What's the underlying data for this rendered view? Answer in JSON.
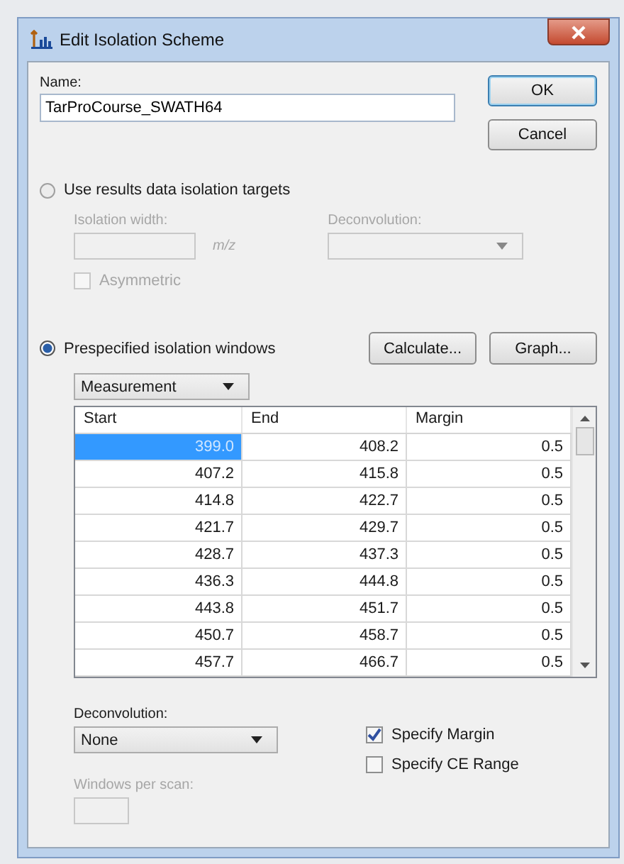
{
  "window": {
    "title": "Edit Isolation Scheme"
  },
  "name": {
    "label": "Name:",
    "value": "TarProCourse_SWATH64"
  },
  "dialog_buttons": [
    {
      "label": "OK",
      "default": true
    },
    {
      "label": "Cancel",
      "default": false
    }
  ],
  "results_option": {
    "label": "Use results data isolation targets",
    "selected": false,
    "isolation_width_label": "Isolation width:",
    "unit": "m/z",
    "deconvolution_label": "Deconvolution:",
    "asymmetric": {
      "label": "Asymmetric",
      "checked": false
    }
  },
  "prespecified_option": {
    "label": "Prespecified isolation windows",
    "selected": true,
    "buttons": [
      "Calculate...",
      "Graph..."
    ],
    "mode": "Measurement"
  },
  "table": {
    "columns": [
      "Start",
      "End",
      "Margin"
    ],
    "rows": [
      {
        "cells": [
          "399.0",
          "408.2",
          "0.5"
        ],
        "selected": true
      },
      {
        "cells": [
          "407.2",
          "415.8",
          "0.5"
        ],
        "selected": false
      },
      {
        "cells": [
          "414.8",
          "422.7",
          "0.5"
        ],
        "selected": false
      },
      {
        "cells": [
          "421.7",
          "429.7",
          "0.5"
        ],
        "selected": false
      },
      {
        "cells": [
          "428.7",
          "437.3",
          "0.5"
        ],
        "selected": false
      },
      {
        "cells": [
          "436.3",
          "444.8",
          "0.5"
        ],
        "selected": false
      },
      {
        "cells": [
          "443.8",
          "451.7",
          "0.5"
        ],
        "selected": false
      },
      {
        "cells": [
          "450.7",
          "458.7",
          "0.5"
        ],
        "selected": false
      },
      {
        "cells": [
          "457.7",
          "466.7",
          "0.5"
        ],
        "selected": false
      }
    ]
  },
  "deconvolution": {
    "label": "Deconvolution:",
    "value": "None"
  },
  "windows_per_scan": {
    "label": "Windows per scan:",
    "disabled": true
  },
  "checkboxes": [
    {
      "label": "Specify Margin",
      "checked": true
    },
    {
      "label": "Specify CE Range",
      "checked": false
    }
  ]
}
